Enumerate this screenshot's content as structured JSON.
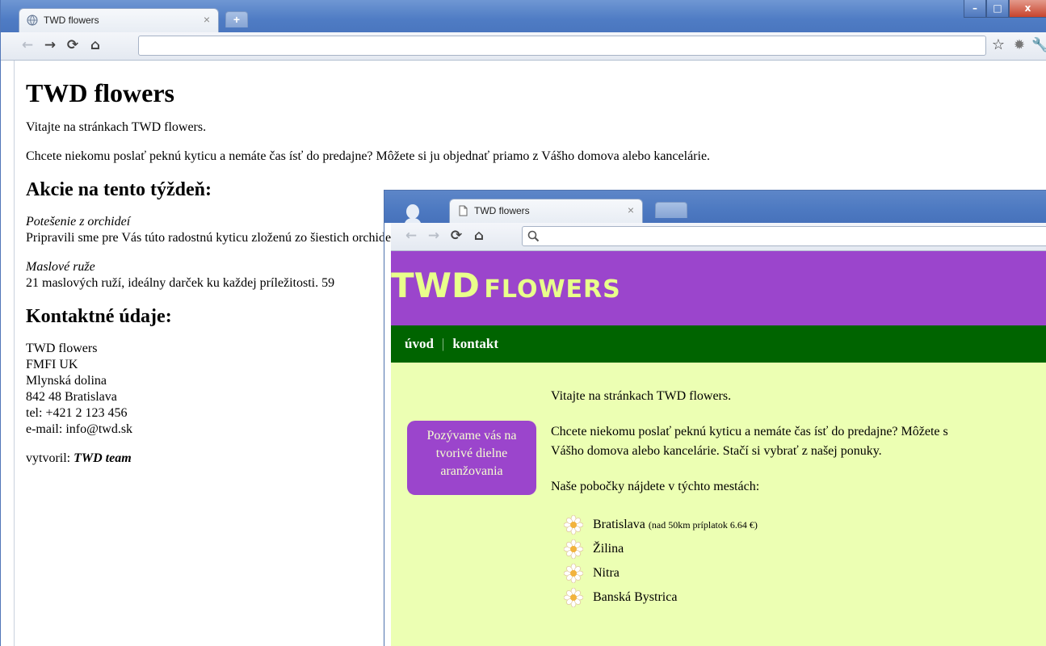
{
  "window1": {
    "tab_title": "TWD flowers",
    "tab_close": "×",
    "newtab": "+",
    "controls": {
      "minimize": "–",
      "maximize": "□",
      "close": "x"
    },
    "page": {
      "heading": "TWD flowers",
      "intro": "Vitajte na stránkach TWD flowers.",
      "paragraph": "Chcete niekomu poslať peknú kyticu a nemáte čas ísť do predajne? Môžete si ju objednať priamo z Vášho domova alebo kancelárie.",
      "offers_heading": "Akcie na tento týždeň:",
      "offer1_title": "Potešenie z orchideí",
      "offer1_text": "Pripravili sme pre Vás túto radostnú kyticu zloženú zo šiestich orchideí.",
      "offer2_title": "Maslové ruže",
      "offer2_text": "21 maslových ruží, ideálny darček ku každej príležitosti. 59",
      "contact_heading": "Kontaktné údaje:",
      "contact_lines": [
        "TWD flowers",
        "FMFI UK",
        "Mlynská dolina",
        "842 48 Bratislava",
        "tel: +421 2 123 456",
        "e-mail: info@twd.sk"
      ],
      "author_label": "vytvoril: ",
      "author_name": "TWD team"
    }
  },
  "window2": {
    "tab_title": "TWD flowers",
    "tab_close": "×",
    "search_icon": "search-icon",
    "page": {
      "logo_big": "TWD",
      "logo_small": "FLOWERS",
      "menu": {
        "home": "úvod",
        "separator": "|",
        "contact": "kontakt"
      },
      "promo": "Pozývame vás na tvorivé dielne aranžovania",
      "intro": "Vitajte na stránkach TWD flowers.",
      "paragraph_line1": "Chcete niekomu poslať peknú kyticu a nemáte čas ísť do predajne? Môžete s",
      "paragraph_line2": "Vášho domova alebo kancelárie. Stačí si vybrať z našej ponuky.",
      "branches_intro": "Naše pobočky nájdete v týchto mestách:",
      "branches": [
        {
          "name": "Bratislava",
          "note": "(nad 50km príplatok 6.64 €)"
        },
        {
          "name": "Žilina",
          "note": ""
        },
        {
          "name": "Nitra",
          "note": ""
        },
        {
          "name": "Banská Bystrica",
          "note": ""
        }
      ]
    }
  },
  "colors": {
    "header_purple": "#9b45cc",
    "logo_yellow": "#e9ff8b",
    "menu_green": "#006400",
    "page_bg": "#ecffb3"
  }
}
